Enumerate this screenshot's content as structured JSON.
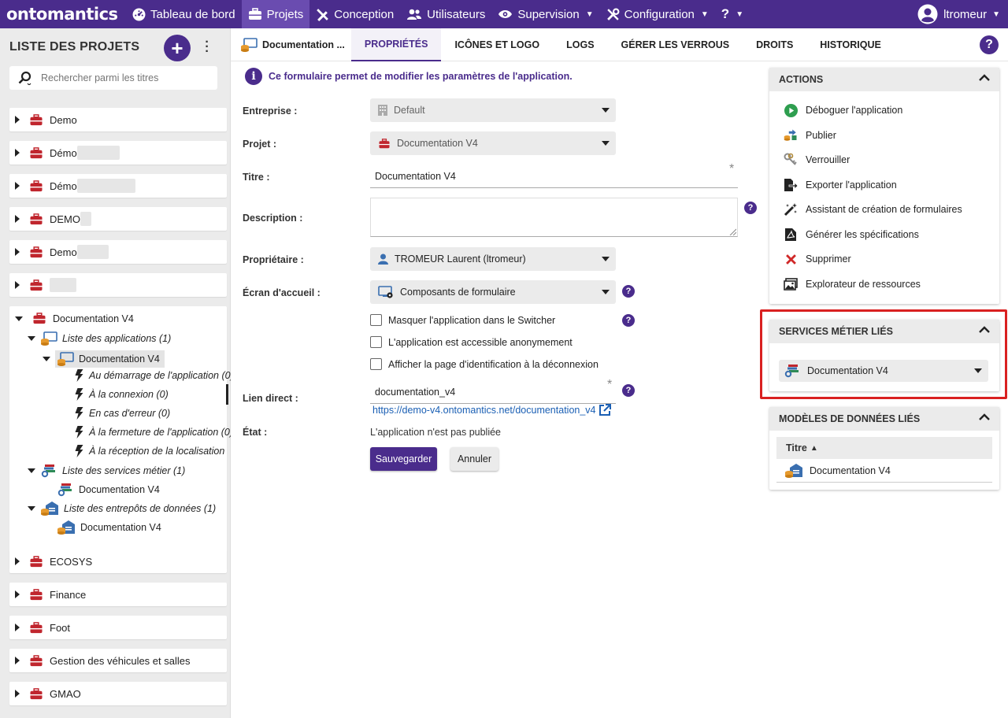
{
  "topbar": {
    "logo": "ontomantics",
    "nav": [
      {
        "label": "Tableau de bord",
        "icon": "dashboard-icon"
      },
      {
        "label": "Projets",
        "icon": "toolbox-icon",
        "active": true
      },
      {
        "label": "Conception",
        "icon": "pencil-ruler-icon"
      },
      {
        "label": "Utilisateurs",
        "icon": "users-icon"
      },
      {
        "label": "Supervision",
        "icon": "eye-icon",
        "caret": true
      },
      {
        "label": "Configuration",
        "icon": "tools-icon",
        "caret": true
      },
      {
        "label": "?",
        "icon": "",
        "caret": true
      }
    ],
    "user": "ltromeur"
  },
  "sidebar": {
    "title": "LISTE DES PROJETS",
    "add_label": "+",
    "search_placeholder": "Rechercher parmi les titres",
    "projects_top": [
      {
        "label": "Demo"
      },
      {
        "label": "Démo"
      },
      {
        "label": "Démo"
      },
      {
        "label": "DEMO"
      },
      {
        "label": "Demo"
      },
      {
        "label": ""
      }
    ],
    "expanded": {
      "label": "Documentation V4",
      "apps_list": "Liste des applications (1)",
      "app": "Documentation V4",
      "events": [
        "Au démarrage de l'application (0)",
        "À la connexion (0)",
        "En cas d'erreur (0)",
        "À la fermeture de l'application (0)",
        "À la réception de la localisation (0"
      ],
      "services_list": "Liste des services métier (1)",
      "service": "Documentation V4",
      "stores_list": "Liste des entrepôts de données (1)",
      "store": "Documentation V4"
    },
    "projects_bottom": [
      {
        "label": "ECOSYS"
      },
      {
        "label": "Finance"
      },
      {
        "label": "Foot"
      },
      {
        "label": "Gestion des véhicules et salles"
      },
      {
        "label": "GMAO"
      }
    ]
  },
  "tabs": {
    "doc_title": "Documentation ...",
    "items": [
      "PROPRIÉTÉS",
      "ICÔNES ET LOGO",
      "LOGS",
      "GÉRER LES VERROUS",
      "DROITS",
      "HISTORIQUE"
    ],
    "help": "?"
  },
  "form": {
    "info": "Ce formulaire permet de modifier les paramètres de l'application.",
    "enterprise_label": "Entreprise :",
    "enterprise_value": "Default",
    "project_label": "Projet :",
    "project_value": "Documentation V4",
    "title_label": "Titre :",
    "title_value": "Documentation V4",
    "description_label": "Description :",
    "description_value": "",
    "owner_label": "Propriétaire :",
    "owner_value": "TROMEUR Laurent (ltromeur)",
    "home_label": "Écran d'accueil :",
    "home_value": "Composants de formulaire",
    "checks": [
      "Masquer l'application dans le Switcher",
      "L'application est accessible anonymement",
      "Afficher la page d'identification à la déconnexion"
    ],
    "link_label": "Lien direct :",
    "link_value": "documentation_v4",
    "link_url": "https://demo-v4.ontomantics.net/documentation_v4",
    "state_label": "État :",
    "state_value": "L'application n'est pas publiée",
    "save_label": "Sauvegarder",
    "cancel_label": "Annuler",
    "required_mark": "*",
    "help_mark": "?"
  },
  "actions": {
    "title": "ACTIONS",
    "items": [
      {
        "label": "Déboguer l'application",
        "icon": "play-icon"
      },
      {
        "label": "Publier",
        "icon": "publish-icon"
      },
      {
        "label": "Verrouiller",
        "icon": "keys-icon"
      },
      {
        "label": "Exporter l'application",
        "icon": "export-icon"
      },
      {
        "label": "Assistant de création de formulaires",
        "icon": "magic-wand-icon"
      },
      {
        "label": "Générer les spécifications",
        "icon": "pdf-icon"
      },
      {
        "label": "Supprimer",
        "icon": "delete-icon"
      },
      {
        "label": "Explorateur de ressources",
        "icon": "image-icon"
      }
    ]
  },
  "services": {
    "title": "SERVICES MÉTIER LIÉS",
    "value": "Documentation V4"
  },
  "models": {
    "title": "MODÈLES DE DONNÉES LIÉS",
    "column": "Titre",
    "rows": [
      "Documentation V4"
    ]
  },
  "colors": {
    "brand": "#4a2c8c",
    "highlight": "#d92020",
    "toolbox": "#c0262e"
  }
}
